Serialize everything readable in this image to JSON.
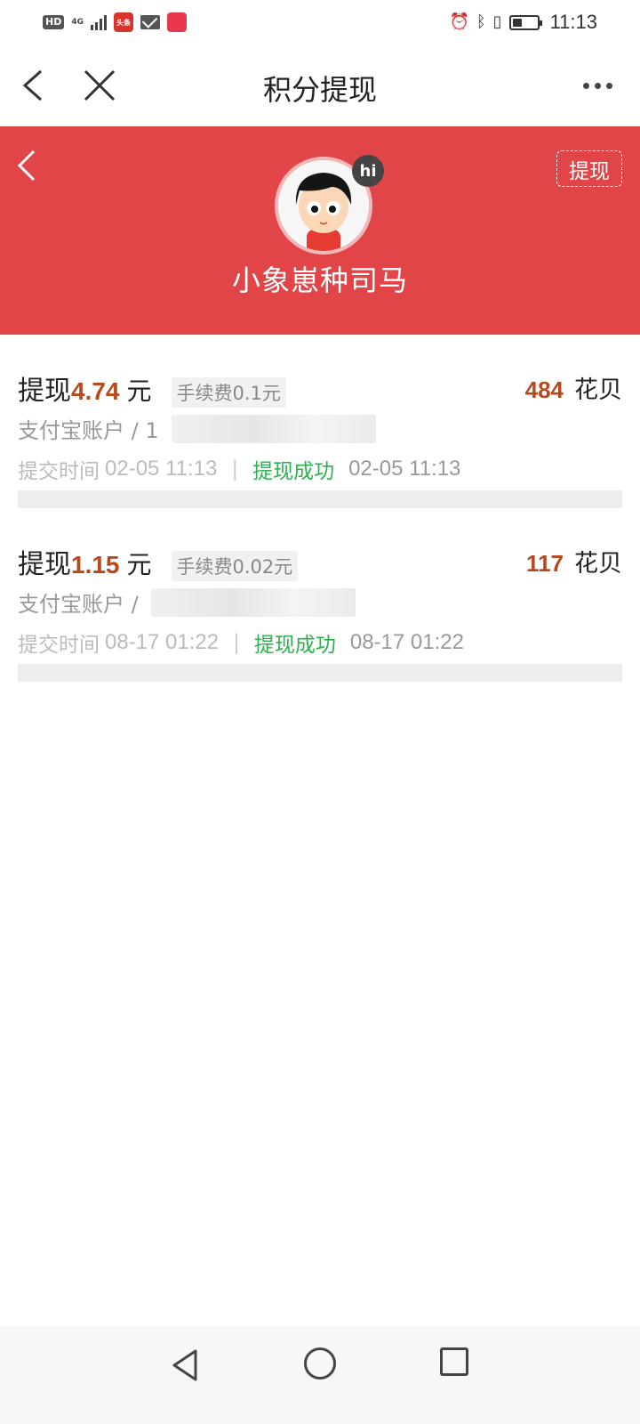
{
  "status_bar": {
    "hd": "HD",
    "network": "4G",
    "app_badge_text": "头条",
    "time": "11:13",
    "battery_percent": 40
  },
  "nav": {
    "title": "积分提现"
  },
  "header": {
    "username": "小象崽种司马",
    "withdraw_label": "提现",
    "hi_badge": "hi",
    "accent_color": "#e24548"
  },
  "records": [
    {
      "label": "提现",
      "amount": "4.74",
      "unit": "元",
      "fee": "手续费0.1元",
      "points": "484",
      "points_unit": "花贝",
      "account": "支付宝账户 / 1",
      "submit_label": "提交时间",
      "submit_time": "02-05 11:13",
      "separator": "|",
      "status": "提现成功",
      "done_time": "02-05 11:13"
    },
    {
      "label": "提现",
      "amount": "1.15",
      "unit": "元",
      "fee": "手续费0.02元",
      "points": "117",
      "points_unit": "花贝",
      "account": "支付宝账户 /",
      "submit_label": "提交时间",
      "submit_time": "08-17 01:22",
      "separator": "|",
      "status": "提现成功",
      "done_time": "08-17 01:22"
    }
  ]
}
